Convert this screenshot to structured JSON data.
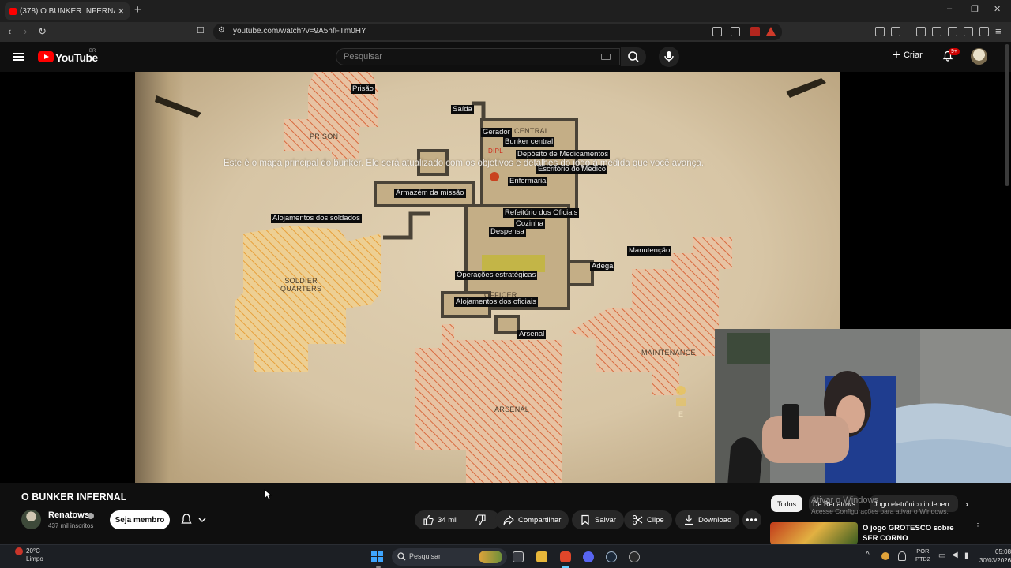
{
  "browser": {
    "tab_title": "(378) O BUNKER INFERNAL -",
    "url": "youtube.com/watch?v=9A5hfFTm0HY"
  },
  "header": {
    "logo_text": "YouTube",
    "country_code": "BR",
    "search_placeholder": "Pesquisar",
    "create_label": "Criar",
    "notification_count": "9+"
  },
  "player": {
    "subtitle": "Este é o mapa principal do bunker. Ele será atualizado com os objetivos e detalhes do jogo à medida que você avança.",
    "map_labels": [
      "Prisão",
      "Saída",
      "Gerador",
      "CENTRAL",
      "Bunker central",
      "Depósito de Medicamentos",
      "Escritório do Médico",
      "Enfermaria",
      "Armazém da missão",
      "Alojamentos dos soldados",
      "Refeitório dos Oficiais",
      "Cozinha",
      "Despensa",
      "Manutenção",
      "Adega",
      "Operações estratégicas",
      "Alojamentos dos oficiais",
      "Arsenal"
    ],
    "map_captions": {
      "prison": "PRISON",
      "soldier_quarters": "SOLDIER\nQUARTERS",
      "officer": "OFFICER",
      "maintenance": "MAINTENANCE",
      "arsenal": "ARSENAL",
      "dipl": "DIPL",
      "key_hint": "E"
    }
  },
  "video": {
    "title": "O BUNKER INFERNAL",
    "channel": "Renatows",
    "subscribers": "437 mil inscritos",
    "join_label": "Seja membro",
    "likes": "34 mil",
    "share_label": "Compartilhar",
    "save_label": "Salvar",
    "clip_label": "Clipe",
    "download_label": "Download"
  },
  "sidebar": {
    "chips": [
      "Todos",
      "De Renatows",
      "Jogo eletrônico indepen"
    ],
    "windows_watermark": "Ativar o Windows",
    "windows_watermark_sub": "Acesse Configurações para ativar o Windows.",
    "recommended_title": "O jogo GROTESCO sobre SER CORNO"
  },
  "taskbar": {
    "weather_temp": "20°C",
    "weather_desc": "Limpo",
    "search_placeholder": "Pesquisar",
    "lang_top": "POR",
    "lang_bottom": "PTB2",
    "time": "05:08",
    "date": "30/03/2026"
  },
  "colors": {
    "yt_red": "#ff0000",
    "map_hatch": "#d9693e",
    "map_hatch_yellow": "#e8a03a",
    "bg": "#0f0f0f"
  }
}
